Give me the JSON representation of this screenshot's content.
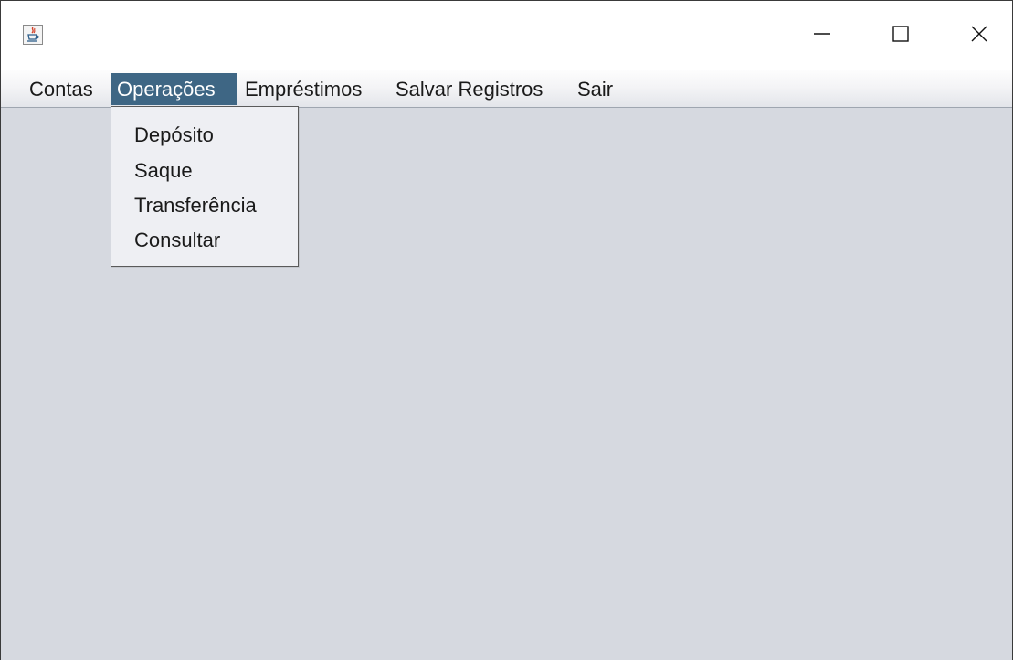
{
  "window": {
    "icon": "java-coffee-cup-icon",
    "controls": {
      "minimize_icon": "minimize-icon",
      "maximize_icon": "maximize-icon",
      "close_icon": "close-icon"
    }
  },
  "menubar": {
    "items": [
      {
        "label": "Contas",
        "active": false
      },
      {
        "label": "Operações",
        "active": true
      },
      {
        "label": "Empréstimos",
        "active": false
      },
      {
        "label": "Salvar Registros",
        "active": false
      },
      {
        "label": "Sair",
        "active": false
      }
    ]
  },
  "dropdown": {
    "items": [
      {
        "label": "Depósito"
      },
      {
        "label": "Saque"
      },
      {
        "label": "Transferência"
      },
      {
        "label": "Consultar"
      }
    ]
  },
  "colors": {
    "menu_active_bg": "#3e6684",
    "content_bg": "#d6d9e0",
    "dropdown_bg": "#eeeff3"
  }
}
